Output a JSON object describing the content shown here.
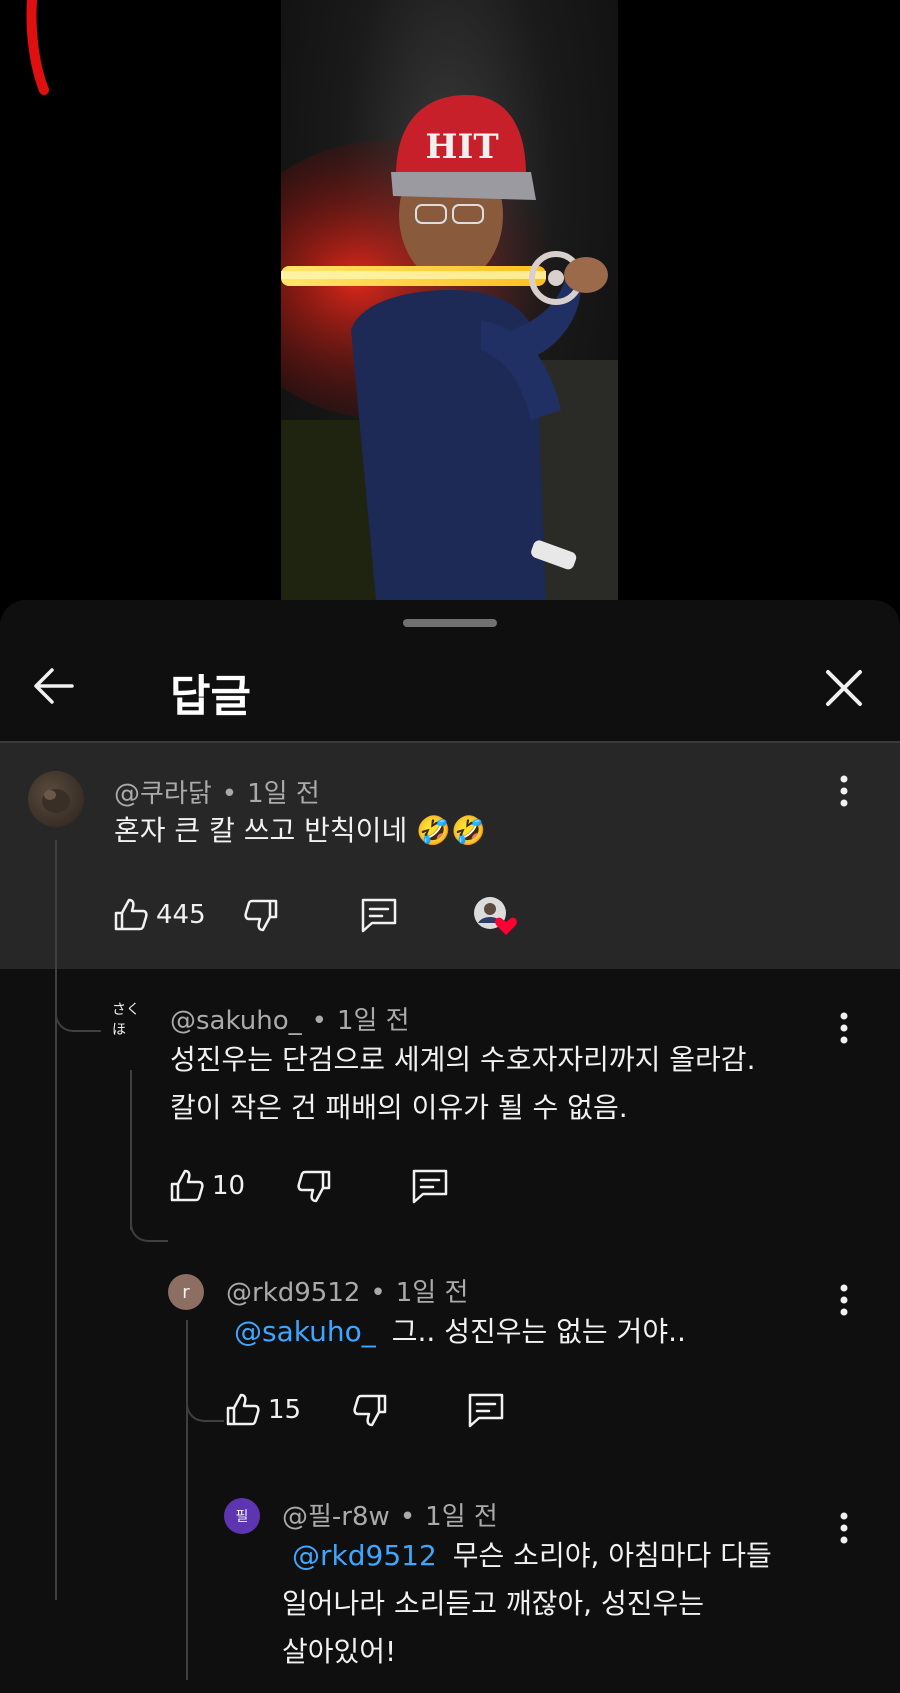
{
  "header": {
    "title": "답글",
    "back_icon": "arrow-left-icon",
    "close_icon": "close-icon"
  },
  "video": {
    "cap_text": "HIT"
  },
  "comments": [
    {
      "author": "@쿠라닭",
      "separator": "•",
      "time": "1일 전",
      "text": "혼자 큰 칼 쓰고 반칙이네 🤣🤣",
      "likes": "445",
      "hearted": true
    },
    {
      "author": "@sakuho_",
      "avatar_text": "さくほ",
      "separator": "•",
      "time": "1일 전",
      "text_lines": [
        "성진우는 단검으로 세계의 수호자자리까지 올라감.",
        "칼이 작은 건 패배의 이유가 될 수 없음."
      ],
      "likes": "10"
    },
    {
      "author": "@rkd9512",
      "avatar_text": "r",
      "avatar_color": "#8d6e63",
      "separator": "•",
      "time": "1일 전",
      "mention": "@sakuho_",
      "text": "그.. 성진우는 없는 거야..",
      "likes": "15"
    },
    {
      "author": "@필-r8w",
      "avatar_text": "필",
      "avatar_color": "#5e35b1",
      "separator": "•",
      "time": "1일 전",
      "mention": "@rkd9512",
      "text_lines": [
        "무슨 소리야,  아침마다 다들",
        "일어나라 소리듣고 깨잖아, 성진우는",
        "살아있어!"
      ]
    }
  ],
  "colors": {
    "sheet_bg": "#0f0f0f",
    "highlight_bg": "#272727",
    "mention": "#3ea6ff",
    "heart": "#ff0033"
  }
}
